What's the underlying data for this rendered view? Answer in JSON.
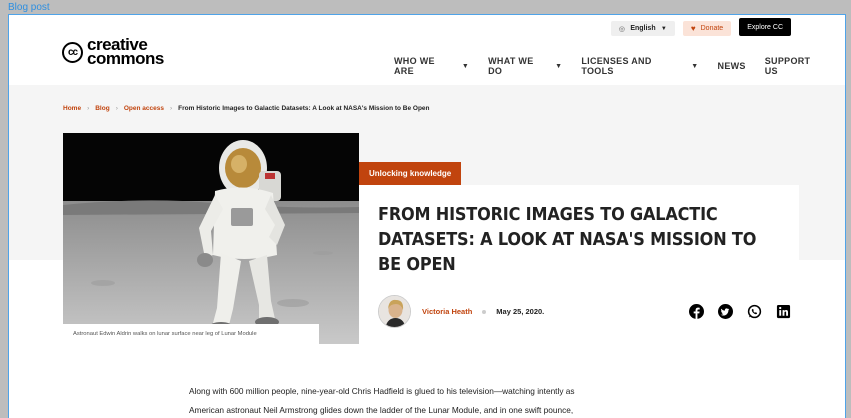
{
  "frame_label": "Blog post",
  "utility": {
    "language": "English",
    "donate": "Donate",
    "explore": "Explore CC"
  },
  "logo": {
    "mark": "cc",
    "line1": "creative",
    "line2": "commons"
  },
  "nav": [
    {
      "label": "WHO WE ARE",
      "has_menu": true
    },
    {
      "label": "WHAT WE DO",
      "has_menu": true
    },
    {
      "label": "LICENSES AND TOOLS",
      "has_menu": true
    },
    {
      "label": "NEWS",
      "has_menu": false
    },
    {
      "label": "SUPPORT US",
      "has_menu": false
    }
  ],
  "breadcrumb": {
    "home": "Home",
    "blog": "Blog",
    "category": "Open access",
    "current": "From Historic Images to Galactic Datasets: A Look at NASA's Mission to Be Open"
  },
  "hero": {
    "caption": "Astronaut Edwin Aldrin walks on lunar surface near leg of Lunar Module"
  },
  "post": {
    "tag": "Unlocking knowledge",
    "title": "FROM HISTORIC IMAGES TO GALACTIC DATASETS: A LOOK AT NASA'S MISSION TO BE OPEN",
    "author": "Victoria Heath",
    "date": "May 25, 2020."
  },
  "share_icons": [
    "facebook-icon",
    "twitter-icon",
    "whatsapp-icon",
    "linkedin-icon"
  ],
  "body": {
    "line1": "Along with 600 million people, nine-year-old Chris Hadfield is glued to his television—watching intently as",
    "line2": "American astronaut Neil Armstrong glides down the ladder of the Lunar Module, and in one swift pounce,"
  },
  "colors": {
    "accent": "#c1440e",
    "frame": "#4fa3e8"
  }
}
